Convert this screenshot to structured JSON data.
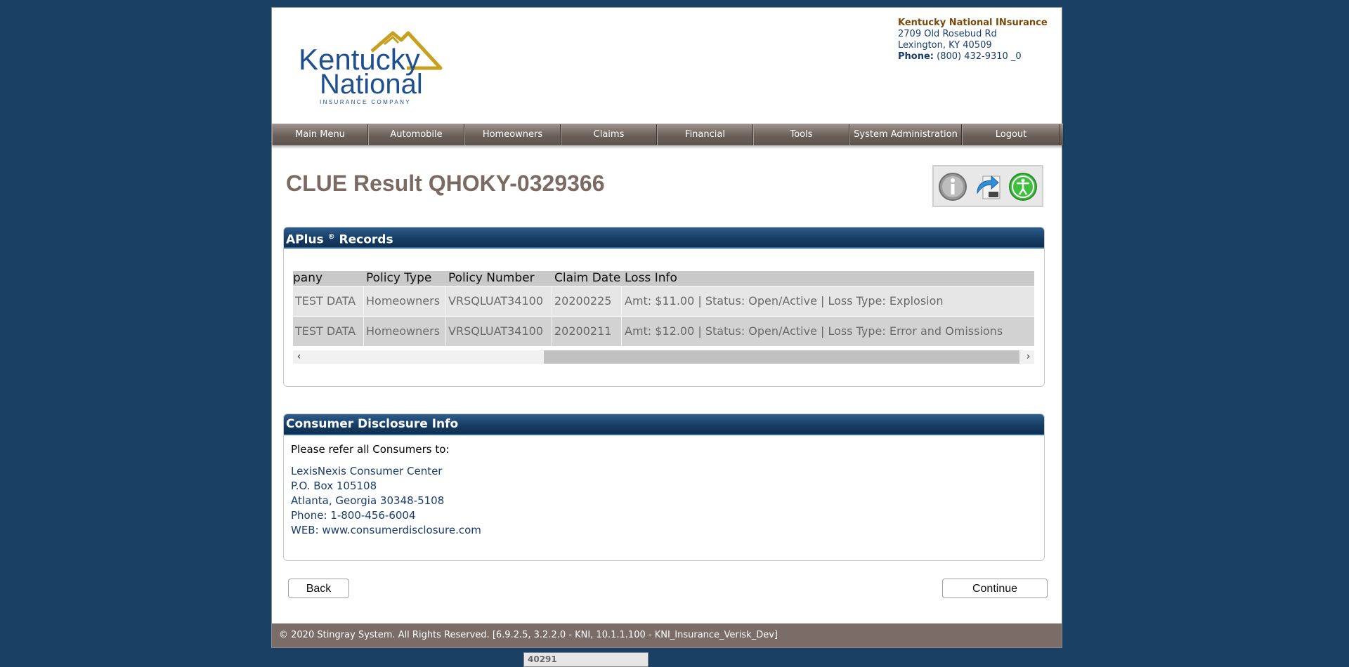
{
  "header": {
    "logo_line1": "Kentucky",
    "logo_line2": "National",
    "logo_tagline": "INSURANCE COMPANY",
    "company": "Kentucky National INsurance",
    "street": "2709 Old Rosebud Rd",
    "city": "Lexington, KY 40509",
    "phone_label": "Phone:",
    "phone": "(800) 432-9310 _0"
  },
  "nav": [
    "Main Menu",
    "Automobile",
    "Homeowners",
    "Claims",
    "Financial",
    "Tools",
    "System Administration",
    "Logout"
  ],
  "page_title": "CLUE Result QHOKY-0329366",
  "records": {
    "heading": "APlus",
    "heading_sup": "®",
    "heading_suffix": "Records",
    "columns": [
      "pany",
      "Policy Type",
      "Policy Number",
      "Claim Date",
      "Loss Info"
    ],
    "rows": [
      [
        "TEST DATA",
        "Homeowners",
        "VRSQLUAT34100",
        "20200225",
        "Amt: $11.00 | Status: Open/Active | Loss Type: Explosion"
      ],
      [
        "TEST DATA",
        "Homeowners",
        "VRSQLUAT34100",
        "20200211",
        "Amt: $12.00 | Status: Open/Active | Loss Type: Error and Omissions"
      ]
    ],
    "scroll_left": "‹",
    "scroll_right": "›"
  },
  "disclosure": {
    "heading": "Consumer Disclosure Info",
    "lead": "Please refer all Consumers to:",
    "lines": [
      "LexisNexis Consumer Center",
      "P.O. Box 105108",
      "Atlanta, Georgia 30348-5108",
      "Phone: 1-800-456-6004",
      "WEB: www.consumerdisclosure.com"
    ]
  },
  "buttons": {
    "back": "Back",
    "continue": "Continue"
  },
  "footer": "© 2020 Stingray System. All Rights Reserved. [6.9.2.5, 3.2.2.0 - KNI, 10.1.1.100 - KNI_Insurance_Verisk_Dev]",
  "tag": "40291",
  "colors": {
    "background": "#1a4163",
    "panel_header": "#163c63",
    "nav": "#6b5f5a",
    "footer": "#7a6c67",
    "title": "#7a6a62"
  },
  "icons": [
    "info-icon",
    "share-icon",
    "accessibility-icon"
  ]
}
